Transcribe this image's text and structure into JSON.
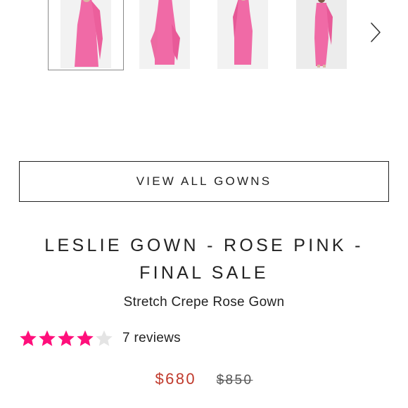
{
  "gallery": {
    "thumbnails": [
      {
        "icon": "gown-front-thumbnail",
        "selected": true
      },
      {
        "icon": "gown-back-thumbnail",
        "selected": false
      },
      {
        "icon": "gown-side-thumbnail",
        "selected": false
      },
      {
        "icon": "gown-model-thumbnail",
        "selected": false
      }
    ],
    "next_icon": "chevron-right-icon"
  },
  "view_all_button": {
    "label": "VIEW ALL GOWNS"
  },
  "product": {
    "title_line1": "LESLIE GOWN - ROSE PINK -",
    "title_line2": "FINAL SALE",
    "subtitle": "Stretch Crepe Rose Gown",
    "rating": {
      "value": 4,
      "max": 5,
      "reviews_label": "7 reviews",
      "filled_color": "#ff0f7b",
      "empty_color": "#e4e4e4"
    },
    "price": {
      "sale": "$680",
      "original": "$850",
      "sale_color": "#c0392b"
    }
  },
  "colors": {
    "gown_pink": "#f06aa6",
    "text": "#222222"
  }
}
